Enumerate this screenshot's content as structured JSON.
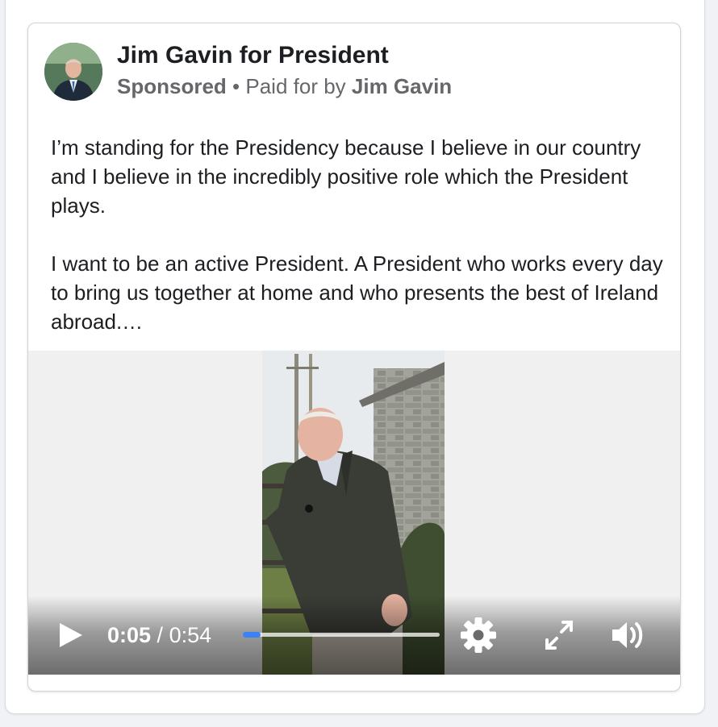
{
  "post": {
    "page_name": "Jim Gavin for President",
    "sponsored_label": "Sponsored",
    "separator": "•",
    "paid_for_by_prefix": "Paid for by",
    "paid_for_by_name": "Jim Gavin",
    "body_paragraphs": [
      "I’m standing for the Presidency because I believe in our country and I believe in the incredibly positive role which the President plays.",
      "I want to be an active President. A President who works every day to bring us together at home and who presents the best of Ireland abroad.…"
    ]
  },
  "video": {
    "current_time": "0:05",
    "time_separator": " / ",
    "duration": "0:54",
    "progress_fraction": 0.09,
    "icons": {
      "play": "play-icon",
      "settings": "gear-icon",
      "fullscreen": "fullscreen-icon",
      "volume": "volume-icon"
    }
  },
  "colors": {
    "progress_accent": "#3b82f6",
    "secondary_text": "#65676b"
  }
}
